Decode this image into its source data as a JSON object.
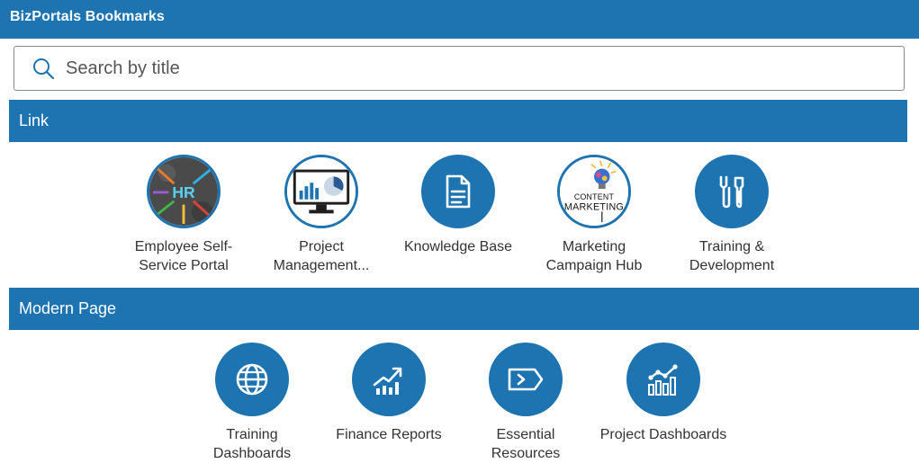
{
  "app": {
    "title": "BizPortals Bookmarks"
  },
  "search": {
    "placeholder": "Search by title",
    "value": ""
  },
  "colors": {
    "primary": "#1d74b0",
    "text": "#333333",
    "border": "#8a8a8a"
  },
  "sections": [
    {
      "title": "Link",
      "items": [
        {
          "label": "Employee Self-Service Portal",
          "icon": "hr-image-icon",
          "image_text": "HR"
        },
        {
          "label": "Project Management...",
          "icon": "monitor-chart-icon"
        },
        {
          "label": "Knowledge Base",
          "icon": "document-icon"
        },
        {
          "label": "Marketing Campaign Hub",
          "icon": "content-marketing-image-icon",
          "image_text": "CONTENT MARKETING"
        },
        {
          "label": "Training & Development",
          "icon": "tools-icon"
        }
      ]
    },
    {
      "title": "Modern Page",
      "items": [
        {
          "label": "Training Dashboards",
          "icon": "globe-icon"
        },
        {
          "label": "Finance Reports",
          "icon": "growth-chart-icon"
        },
        {
          "label": "Essential Resources",
          "icon": "tag-arrow-icon"
        },
        {
          "label": "Project Dashboards",
          "icon": "bar-line-chart-icon"
        }
      ]
    }
  ]
}
